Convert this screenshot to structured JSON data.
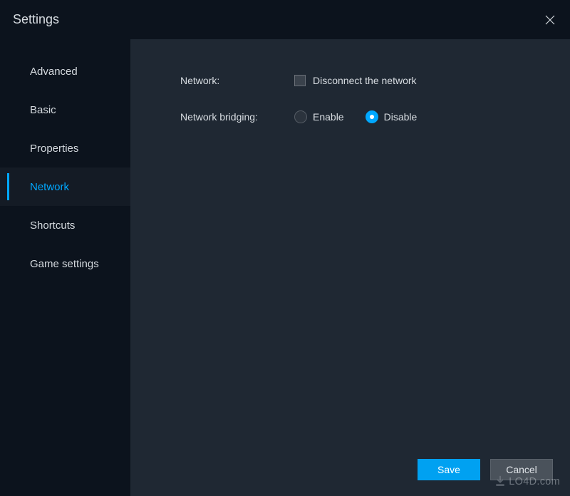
{
  "header": {
    "title": "Settings"
  },
  "sidebar": {
    "items": [
      {
        "label": "Advanced",
        "active": false
      },
      {
        "label": "Basic",
        "active": false
      },
      {
        "label": "Properties",
        "active": false
      },
      {
        "label": "Network",
        "active": true
      },
      {
        "label": "Shortcuts",
        "active": false
      },
      {
        "label": "Game settings",
        "active": false
      }
    ]
  },
  "main": {
    "network": {
      "label": "Network:",
      "checkbox_label": "Disconnect the network",
      "checked": false
    },
    "bridging": {
      "label": "Network bridging:",
      "options": [
        {
          "label": "Enable",
          "selected": false
        },
        {
          "label": "Disable",
          "selected": true
        }
      ]
    }
  },
  "footer": {
    "save_label": "Save",
    "cancel_label": "Cancel"
  },
  "watermark": {
    "text": "LO4D.com"
  }
}
